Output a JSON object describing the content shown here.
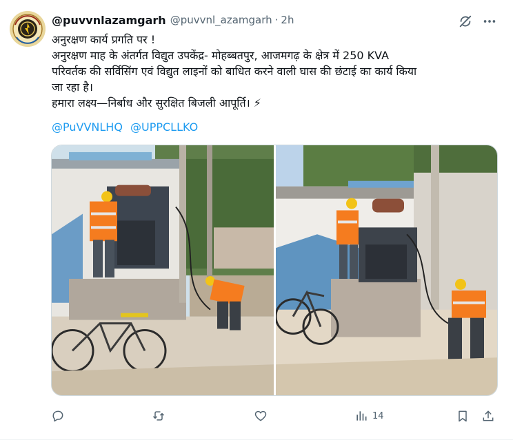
{
  "author": {
    "display_name": "@puvvnlazamgarh",
    "handle": "@puvvnl_azamgarh",
    "separator": "·",
    "time": "2h",
    "avatar_icon": "puvvnl-logo-avatar"
  },
  "tweet": {
    "lines": [
      "अनुरक्षण कार्य प्रगति पर !",
      "अनुरक्षण माह के अंतर्गत विद्युत उपकेंद्र- मोहब्बतपुर, आजमगढ़ के क्षेत्र में 250 KVA",
      "परिवर्तक की सर्विसिंग एवं विद्युत लाइनों को बाधित करने वाली घास की छंटाई का कार्य किया",
      "जा रहा है।",
      "हमारा लक्ष्य—निर्बाध और सुरक्षित बिजली आपूर्ति। ⚡"
    ],
    "mentions": [
      "@PuVVNLHQ",
      "@UPPCLLKO"
    ]
  },
  "media": {
    "photos": [
      "transformer-servicing-photo-1",
      "transformer-servicing-photo-2"
    ]
  },
  "actions": {
    "reply_icon": "reply-icon",
    "retweet_icon": "retweet-icon",
    "like_icon": "heart-icon",
    "views_icon": "views-icon",
    "views_count": "14",
    "bookmark_icon": "bookmark-icon",
    "share_icon": "share-icon"
  },
  "colors": {
    "link": "#1d9bf0",
    "muted": "#536471",
    "text": "#0f1419",
    "vest": "#f57c1f",
    "helmet": "#f2c318"
  }
}
